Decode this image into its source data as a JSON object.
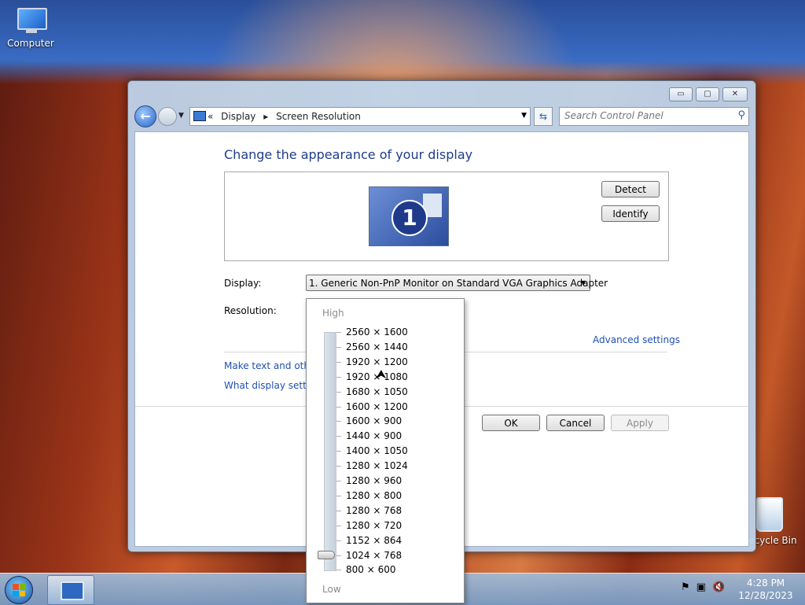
{
  "desktop": {
    "computer_label": "Computer",
    "recycle_label": "Recycle Bin"
  },
  "window": {
    "caption_buttons": {
      "minimize": "▭",
      "maximize": "▢",
      "close": "✕"
    },
    "address": {
      "prefix": "«",
      "crumb1": "Display",
      "sep": "▸",
      "crumb2": "Screen Resolution"
    },
    "search_placeholder": "Search Control Panel",
    "title": "Change the appearance of your display",
    "monitor_number": "1",
    "detect_label": "Detect",
    "identify_label": "Identify",
    "display_label": "Display:",
    "display_value": "1. Generic Non-PnP Monitor on Standard VGA Graphics Adapter",
    "resolution_label": "Resolution:",
    "advanced_link": "Advanced settings",
    "link1": "Make text and other",
    "link2": "What display setting",
    "ok_label": "OK",
    "cancel_label": "Cancel",
    "apply_label": "Apply"
  },
  "resolution_dropdown": {
    "high_label": "High",
    "low_label": "Low",
    "selected": "1024 × 768",
    "options": [
      "2560 × 1600",
      "2560 × 1440",
      "1920 × 1200",
      "1920 × 1080",
      "1680 × 1050",
      "1600 × 1200",
      "1600 × 900",
      "1440 × 900",
      "1400 × 1050",
      "1280 × 1024",
      "1280 × 960",
      "1280 × 800",
      "1280 × 768",
      "1280 × 720",
      "1152 × 864",
      "1024 × 768",
      "800 × 600"
    ]
  },
  "taskbar": {
    "time": "4:28 PM",
    "date": "12/28/2023"
  },
  "colors": {
    "title_blue": "#1e3c8c",
    "link_blue": "#1e50b4"
  }
}
